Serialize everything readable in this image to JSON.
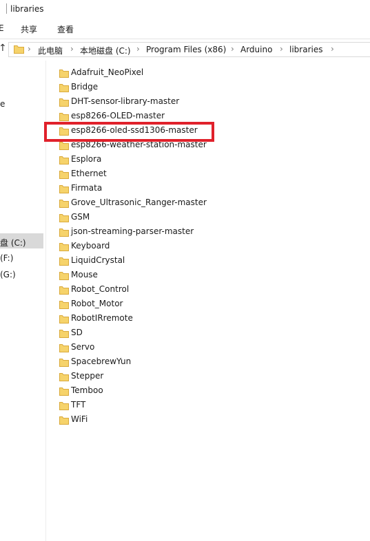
{
  "window": {
    "title": "libraries"
  },
  "ribbon": {
    "tab_partial": "E",
    "share": "共享",
    "view": "查看"
  },
  "address": {
    "crumbs": [
      "此电脑",
      "本地磁盘 (C:)",
      "Program Files (x86)",
      "Arduino",
      "libraries"
    ],
    "separator": "›"
  },
  "nav": {
    "items": [
      "e",
      "盘 (C:)",
      "(F:)",
      "(G:)"
    ],
    "selected_index": 1,
    "up_glyph": "↑"
  },
  "files": [
    "Adafruit_NeoPixel",
    "Bridge",
    "DHT-sensor-library-master",
    "esp8266-OLED-master",
    "esp8266-oled-ssd1306-master",
    "esp8266-weather-station-master",
    "Esplora",
    "Ethernet",
    "Firmata",
    "Grove_Ultrasonic_Ranger-master",
    "GSM",
    "json-streaming-parser-master",
    "Keyboard",
    "LiquidCrystal",
    "Mouse",
    "Robot_Control",
    "Robot_Motor",
    "RobotIRremote",
    "SD",
    "Servo",
    "SpacebrewYun",
    "Stepper",
    "Temboo",
    "TFT",
    "WiFi"
  ],
  "highlighted_file": "esp8266-oled-ssd1306-master",
  "icons": {
    "folder": "folder-icon",
    "highlight_color": "#e0212b",
    "folder_color": "#f6d36b"
  }
}
